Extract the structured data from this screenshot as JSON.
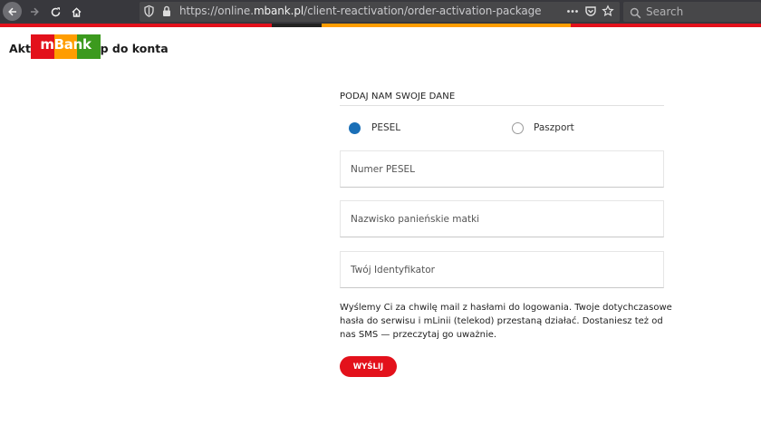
{
  "browser": {
    "url_prefix": "https://online.",
    "url_domain": "mbank.pl",
    "url_path": "/client-reactivation/order-activation-package",
    "search_placeholder": "Search"
  },
  "page": {
    "title": "Aktywuj dostęp do konta",
    "logo_text": "mBank",
    "logo_colors": [
      "#e3111b",
      "#ff9d00",
      "#3c9a1e"
    ]
  },
  "form": {
    "heading": "PODAJ NAM SWOJE DANE",
    "doc_types": [
      {
        "label": "PESEL",
        "selected": true
      },
      {
        "label": "Paszport",
        "selected": false
      }
    ],
    "fields": [
      {
        "placeholder": "Numer PESEL",
        "value": ""
      },
      {
        "placeholder": "Nazwisko panieńskie matki",
        "value": ""
      },
      {
        "placeholder": "Twój Identyfikator",
        "value": ""
      }
    ],
    "info": "Wyślemy Ci za chwilę mail z hasłami do logowania. Twoje dotychczasowe hasła do serwisu i mLinii (telekod) przestaną działać. Dostaniesz też od nas SMS — przeczytaj go uważnie.",
    "submit_label": "WYŚLIJ"
  },
  "colors": {
    "accent": "#e3111b",
    "radio_selected": "#1a6fb7",
    "browser_bg": "#38383d"
  }
}
